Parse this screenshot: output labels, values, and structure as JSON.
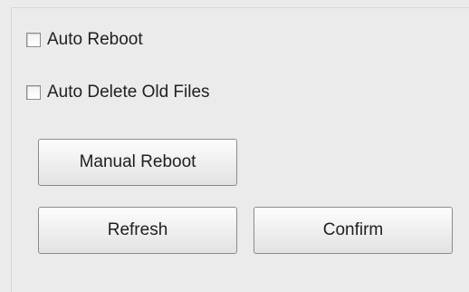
{
  "options": {
    "auto_reboot": {
      "label": "Auto Reboot",
      "checked": false
    },
    "auto_delete_old_files": {
      "label": "Auto Delete Old Files",
      "checked": false
    }
  },
  "buttons": {
    "manual_reboot": "Manual Reboot",
    "refresh": "Refresh",
    "confirm": "Confirm"
  },
  "colors": {
    "background": "#ebebeb",
    "border": "#8a8a8a",
    "text": "#202020"
  }
}
